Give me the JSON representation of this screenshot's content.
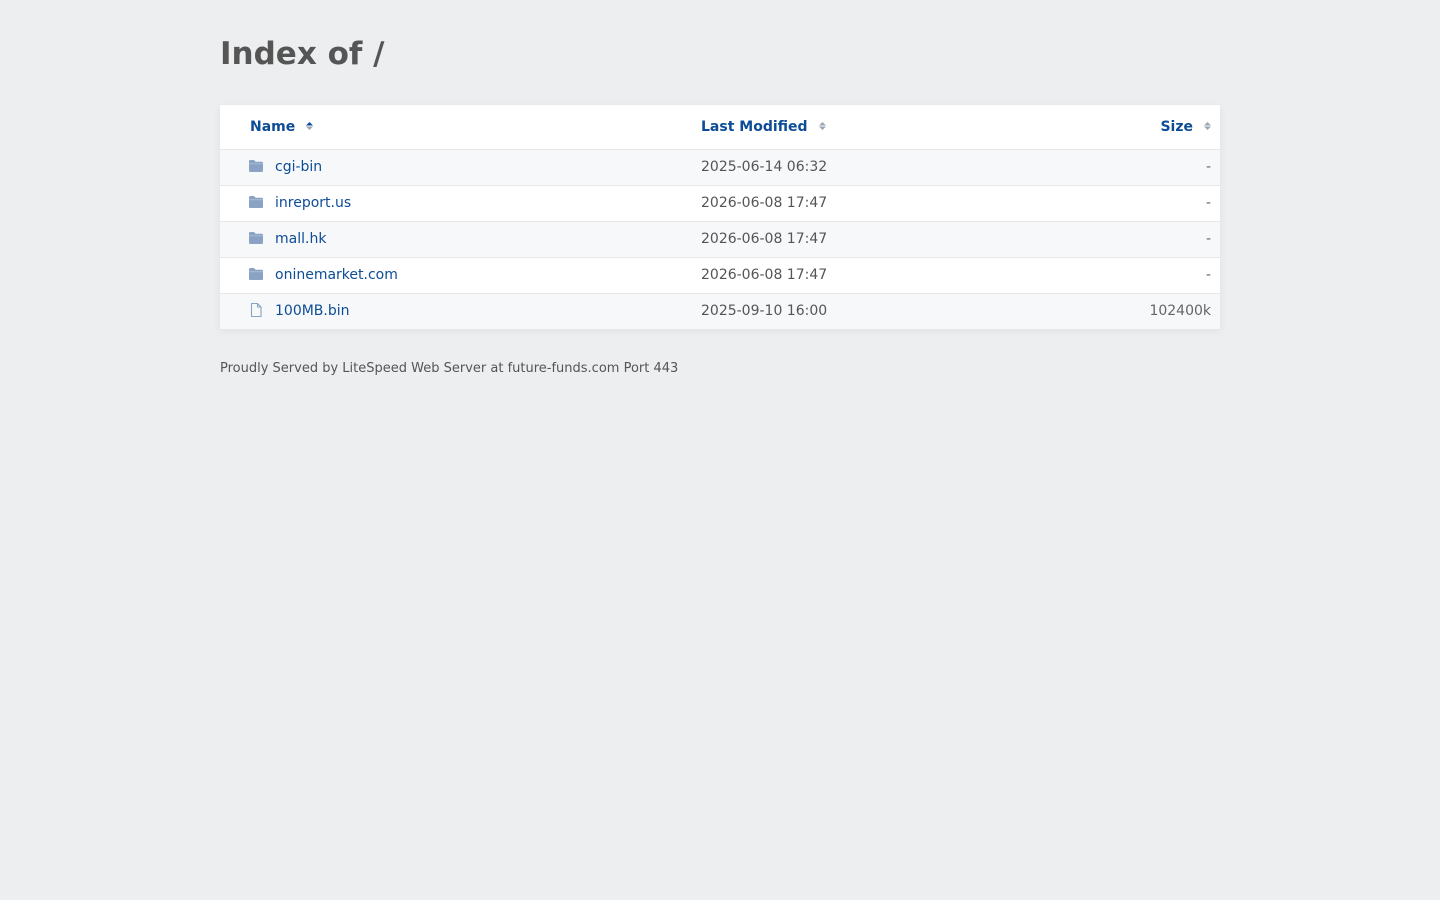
{
  "page": {
    "title": "Index of /"
  },
  "table": {
    "headers": {
      "name": "Name",
      "modified": "Last Modified",
      "size": "Size"
    },
    "rows": [
      {
        "name": "cgi-bin",
        "modified": "2025-06-14 06:32",
        "size": "-",
        "icon": "folder-icon"
      },
      {
        "name": "inreport.us",
        "modified": "2026-06-08 17:47",
        "size": "-",
        "icon": "folder-icon"
      },
      {
        "name": "mall.hk",
        "modified": "2026-06-08 17:47",
        "size": "-",
        "icon": "folder-icon"
      },
      {
        "name": "oninemarket.com",
        "modified": "2026-06-08 17:47",
        "size": "-",
        "icon": "folder-icon"
      },
      {
        "name": "100MB.bin",
        "modified": "2025-09-10 16:00",
        "size": "102400k",
        "icon": "file-icon"
      }
    ]
  },
  "footer": {
    "text": "Proudly Served by LiteSpeed Web Server at future-funds.com Port 443"
  },
  "colors": {
    "background": "#eceef0",
    "link": "#0d4c96",
    "folder_icon": "#8aa2c4",
    "heading": "#555555"
  }
}
